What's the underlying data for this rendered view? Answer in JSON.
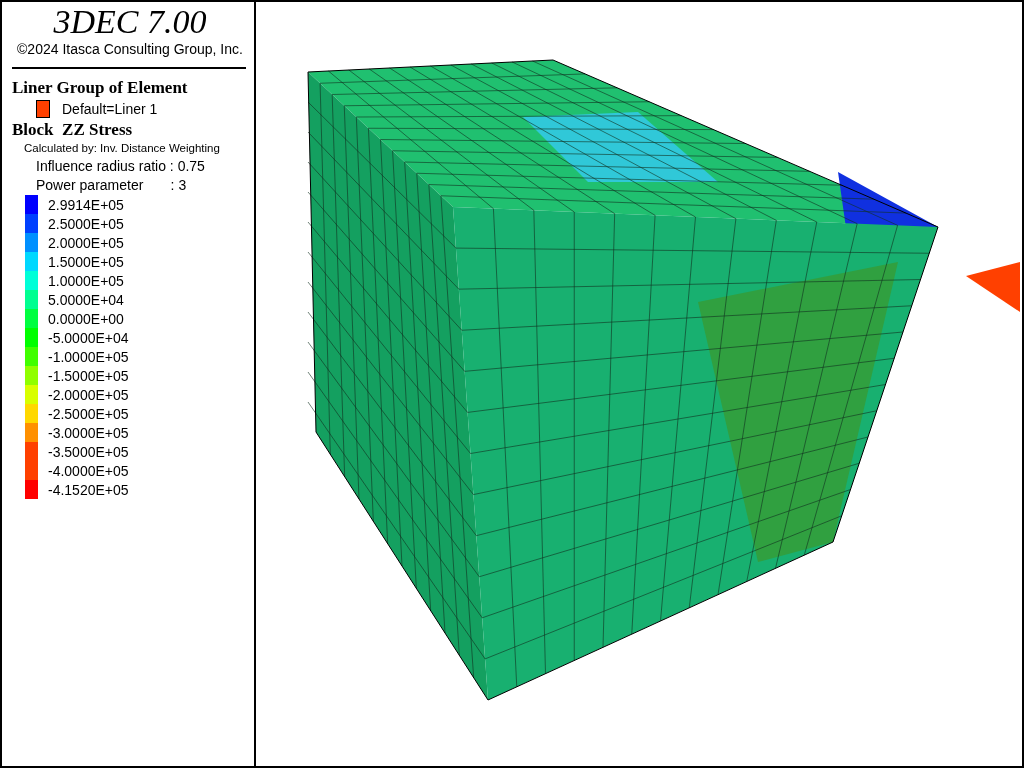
{
  "title": "3DEC 7.00",
  "copyright": "©2024 Itasca Consulting Group, Inc.",
  "liner": {
    "heading": "Liner Group of Element",
    "items": [
      {
        "label": "Default=Liner 1",
        "color": "#ff4000"
      }
    ]
  },
  "contour": {
    "heading": "Block  ZZ Stress",
    "method": "Calculated by: Inv. Distance Weighting",
    "params": [
      "Influence radius ratio : 0.75",
      "Power parameter       : 3"
    ],
    "levels": [
      {
        "label": "2.9914E+05",
        "color": "#0000ff"
      },
      {
        "label": "2.5000E+05",
        "color": "#0040ff"
      },
      {
        "label": "2.0000E+05",
        "color": "#0090ff"
      },
      {
        "label": "1.5000E+05",
        "color": "#00d8ff"
      },
      {
        "label": "1.0000E+05",
        "color": "#00ffd8"
      },
      {
        "label": "5.0000E+04",
        "color": "#00ff90"
      },
      {
        "label": "0.0000E+00",
        "color": "#00ff40"
      },
      {
        "label": "-5.0000E+04",
        "color": "#00ff00"
      },
      {
        "label": "-1.0000E+05",
        "color": "#40ff00"
      },
      {
        "label": "-1.5000E+05",
        "color": "#90ff00"
      },
      {
        "label": "-2.0000E+05",
        "color": "#d8ff00"
      },
      {
        "label": "-2.5000E+05",
        "color": "#ffd800"
      },
      {
        "label": "-3.0000E+05",
        "color": "#ff9000"
      },
      {
        "label": "-3.5000E+05",
        "color": "#ff4000"
      },
      {
        "label": "-4.0000E+05",
        "color": "#ff4000"
      },
      {
        "label": "-4.1520E+05",
        "color": "#ff0000"
      }
    ]
  }
}
